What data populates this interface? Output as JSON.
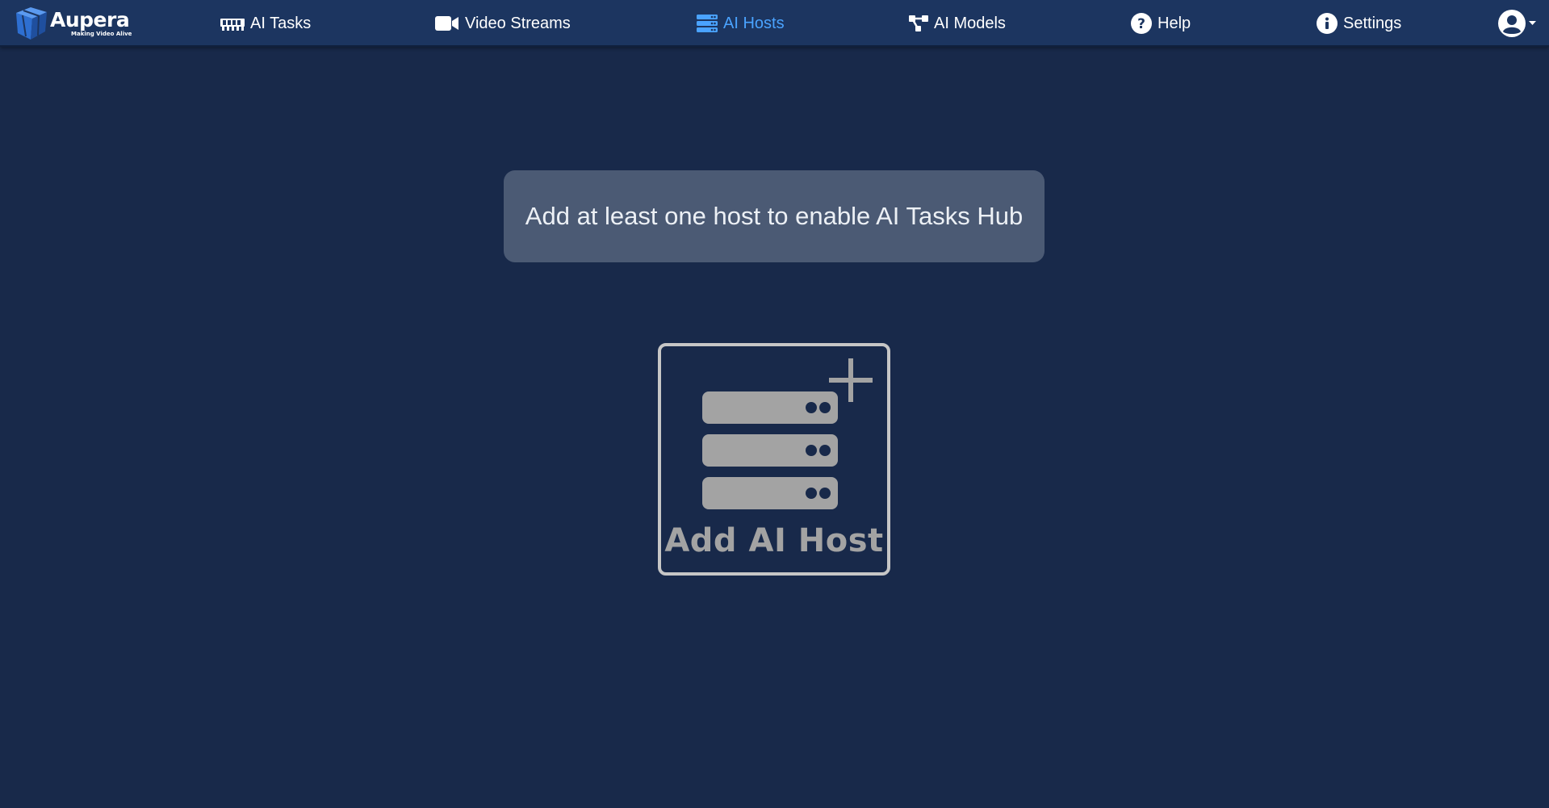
{
  "brand": {
    "name": "Aupera",
    "tagline": "Making Video Alive",
    "colors": {
      "dark": "#1f4f9e",
      "mid": "#2e6fd1",
      "light": "#5b9af0"
    }
  },
  "nav": {
    "items": [
      {
        "label": "AI Tasks",
        "icon": "ai-tasks-icon",
        "active": false
      },
      {
        "label": "Video Streams",
        "icon": "video-camera-icon",
        "active": false
      },
      {
        "label": "AI Hosts",
        "icon": "server-icon",
        "active": true
      },
      {
        "label": "AI Models",
        "icon": "model-network-icon",
        "active": false
      },
      {
        "label": "Help",
        "icon": "question-circle-icon",
        "active": false
      },
      {
        "label": "Settings",
        "icon": "info-circle-icon",
        "active": false
      }
    ],
    "user_icon": "user-circle-icon",
    "dropdown_icon": "caret-down-icon"
  },
  "main": {
    "notice": "Add at least one host to enable AI Tasks Hub",
    "add_host_label": "Add AI Host"
  },
  "colors": {
    "background": "#18294a",
    "navbar": "#1c3560",
    "active_nav": "#4aa3ff",
    "notice_bg": "#4b5a74",
    "card_gray": "#a3a3a3"
  }
}
